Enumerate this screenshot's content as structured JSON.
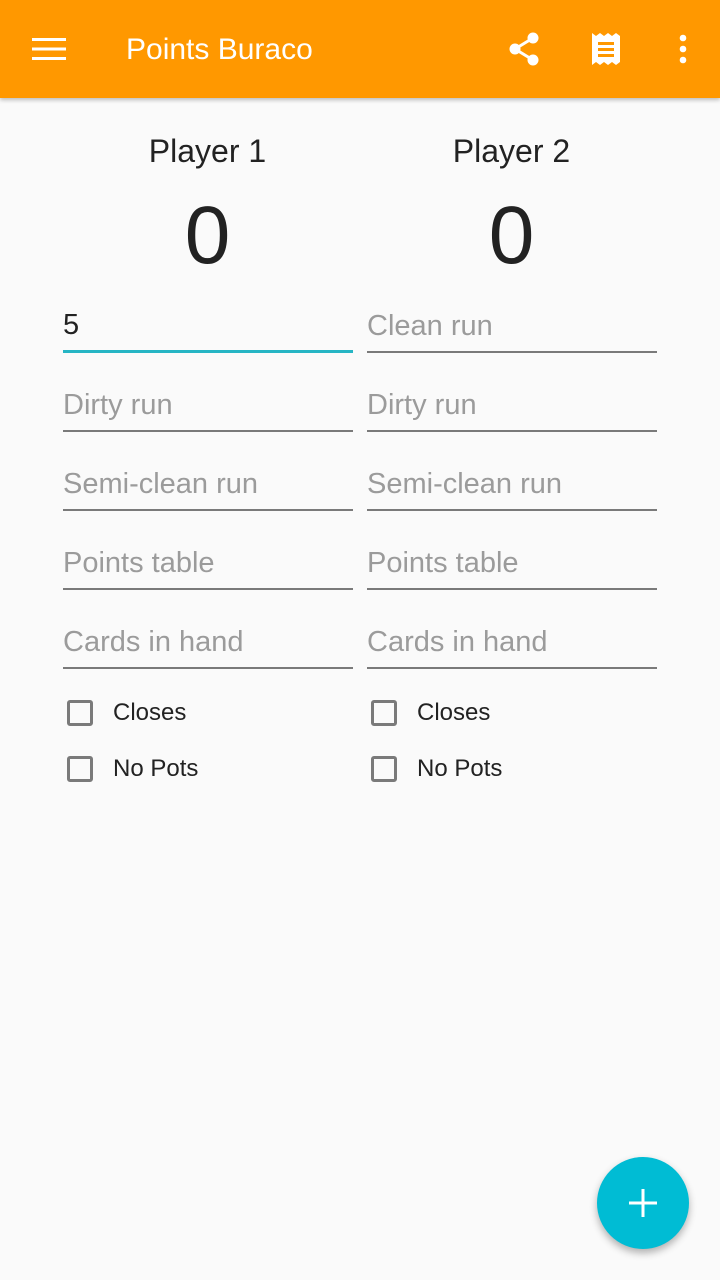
{
  "appbar": {
    "title": "Points Buraco",
    "color": "#ff9800",
    "icons": {
      "menu": "menu-icon",
      "share": "share-icon",
      "receipt": "receipt-icon",
      "more": "more-vert-icon"
    }
  },
  "players": [
    {
      "name": "Player 1",
      "score": "0",
      "fields": {
        "clean_run": {
          "value": "5",
          "placeholder": "Clean run"
        },
        "dirty_run": {
          "value": "",
          "placeholder": "Dirty run"
        },
        "semi_clean_run": {
          "value": "",
          "placeholder": "Semi-clean run"
        },
        "points_table": {
          "value": "",
          "placeholder": "Points table"
        },
        "cards_in_hand": {
          "value": "",
          "placeholder": "Cards in hand"
        }
      },
      "checks": {
        "closes": "Closes",
        "no_pots": "No Pots"
      }
    },
    {
      "name": "Player 2",
      "score": "0",
      "fields": {
        "clean_run": {
          "value": "",
          "placeholder": "Clean run"
        },
        "dirty_run": {
          "value": "",
          "placeholder": "Dirty run"
        },
        "semi_clean_run": {
          "value": "",
          "placeholder": "Semi-clean run"
        },
        "points_table": {
          "value": "",
          "placeholder": "Points table"
        },
        "cards_in_hand": {
          "value": "",
          "placeholder": "Cards in hand"
        }
      },
      "checks": {
        "closes": "Closes",
        "no_pots": "No Pots"
      }
    }
  ],
  "fab": {
    "icon": "plus-icon",
    "color": "#00bcd4"
  },
  "accent": "#26b5c4"
}
